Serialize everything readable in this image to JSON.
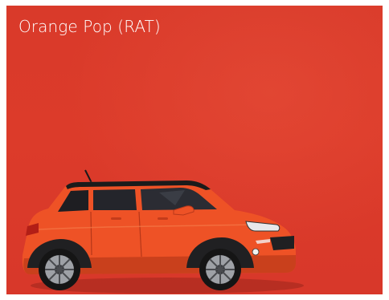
{
  "swatch": {
    "title": "Orange Pop (RAT)",
    "background_color": "#d93a2a",
    "car_color": "#ee5226",
    "roof_color": "#1b1b1b"
  },
  "car_image": {
    "icon": "suv-car-icon"
  }
}
